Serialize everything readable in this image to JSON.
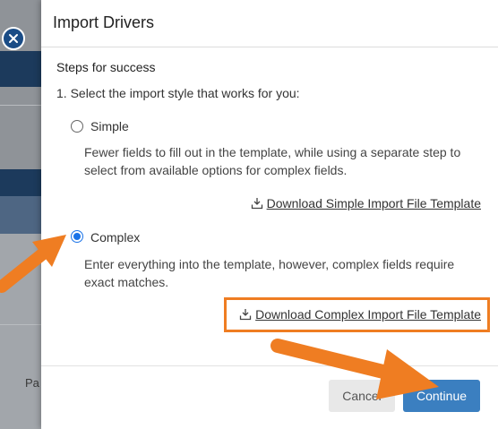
{
  "modal": {
    "title": "Import Drivers",
    "steps_title": "Steps for success",
    "step1": "1. Select the import style that works for you:",
    "options": [
      {
        "label": "Simple",
        "selected": false,
        "description": "Fewer fields to fill out in the template, while using a separate step to select from available options for complex fields.",
        "download_label": "Download Simple Import File Template",
        "download_icon": "download-icon"
      },
      {
        "label": "Complex",
        "selected": true,
        "description": "Enter everything into the template, however, complex fields require exact matches.",
        "download_label": "Download Complex Import File Template",
        "download_icon": "download-icon"
      }
    ],
    "footer": {
      "cancel_label": "Cancel",
      "continue_label": "Continue"
    }
  },
  "background": {
    "text": "Pa",
    "close_icon": "close-icon"
  },
  "colors": {
    "accent": "#1a73e8",
    "primary_button": "#3b7fc0",
    "annotation": "#ef7d22"
  }
}
